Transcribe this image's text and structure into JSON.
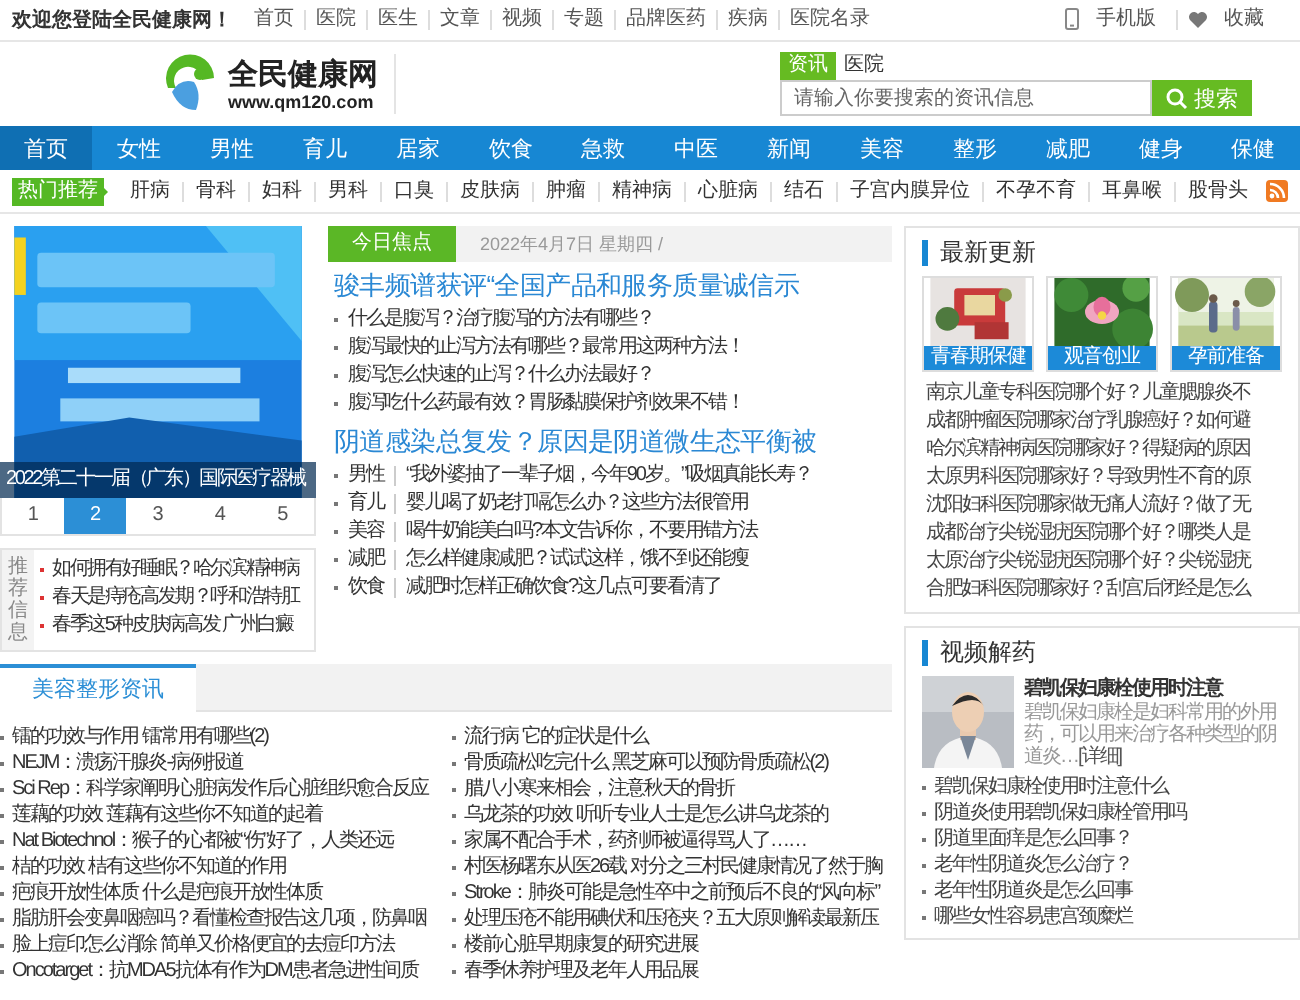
{
  "top_bar": {
    "welcome": "欢迎您登陆全民健康网！",
    "links": [
      "首页",
      "医院",
      "医生",
      "文章",
      "视频",
      "专题",
      "品牌医药",
      "疾病",
      "医院名录"
    ],
    "mobile": "手机版",
    "favorite": "收藏"
  },
  "header": {
    "logo_name": "全民健康网",
    "logo_url": "www.qm120.com",
    "search_tabs": [
      {
        "label": "资讯",
        "selected": true
      },
      {
        "label": "医院",
        "selected": false
      }
    ],
    "search": {
      "placeholder": "请输入你要搜索的资讯信息"
    },
    "search_button": "搜索"
  },
  "nav": [
    {
      "label": "首页",
      "selected": true
    },
    {
      "label": "女性",
      "selected": false
    },
    {
      "label": "男性",
      "selected": false
    },
    {
      "label": "育儿",
      "selected": false
    },
    {
      "label": "居家",
      "selected": false
    },
    {
      "label": "饮食",
      "selected": false
    },
    {
      "label": "急救",
      "selected": false
    },
    {
      "label": "中医",
      "selected": false
    },
    {
      "label": "新闻",
      "selected": false
    },
    {
      "label": "美容",
      "selected": false
    },
    {
      "label": "整形",
      "selected": false
    },
    {
      "label": "减肥",
      "selected": false
    },
    {
      "label": "健身",
      "selected": false
    },
    {
      "label": "保健",
      "selected": false
    }
  ],
  "hot": {
    "badge": "热门推荐",
    "tags": [
      "肝病",
      "骨科",
      "妇科",
      "男科",
      "口臭",
      "皮肤病",
      "肿瘤",
      "精神病",
      "心脏病",
      "结石",
      "子宫内膜异位",
      "不孕不育",
      "耳鼻喉",
      "股骨头"
    ]
  },
  "carousel": {
    "caption": "2022第二十一届（广东）国际医疗器械",
    "pages": [
      {
        "label": "1",
        "selected": false
      },
      {
        "label": "2",
        "selected": true
      },
      {
        "label": "3",
        "selected": false
      },
      {
        "label": "4",
        "selected": false
      },
      {
        "label": "5",
        "selected": false
      }
    ]
  },
  "recommend": {
    "label": "推荐信息",
    "items": [
      "如何拥有好睡眠？哈尔滨精神病",
      "春天是痔疮高发期？呼和浩特肛",
      "春季这5种皮肤病高发 广州白癜"
    ]
  },
  "focus": {
    "tab": "今日焦点",
    "date": "2022年4月7日 星期四 /",
    "groups": [
      {
        "headline": "骏丰频谱获评“全国产品和服务质量诚信示",
        "items": [
          {
            "title": "什么是腹泻？治疗腹泻的方法有哪些？"
          },
          {
            "title": "腹泻最快的止泻方法有哪些？最常用这两种方法！"
          },
          {
            "title": "腹泻怎么快速的止泻？什么办法最好？"
          },
          {
            "title": "腹泻吃什么药最有效？胃肠黏膜保护剂效果不错！"
          }
        ]
      },
      {
        "headline": "阴道感染总复发？原因是阴道微生态平衡被",
        "items": [
          {
            "category": "男性",
            "title": "“我外婆抽了一辈子烟，今年90岁。”吸烟真能长寿？"
          },
          {
            "category": "育儿",
            "title": "婴儿喝了奶老打嗝怎么办？这些方法很管用"
          },
          {
            "category": "美容",
            "title": "喝牛奶能美白吗?本文告诉你，不要用错方法"
          },
          {
            "category": "减肥",
            "title": "怎么样健康减肥？试试这样，饿不到还能瘦"
          },
          {
            "category": "饮食",
            "title": "减肥时怎样正确饮食?这几点可要看清了"
          }
        ]
      }
    ]
  },
  "latest": {
    "title": "最新更新",
    "captions": [
      "青春期保健",
      "观音创业",
      "孕前准备"
    ],
    "items": [
      "南京儿童专科医院哪个好？儿童腮腺炎不",
      "成都肿瘤医院哪家治疗乳腺癌好？如何避",
      "哈尔滨精神病医院哪家好？得疑病的原因",
      "太原男科医院哪家好？导致男性不育的原",
      "沈阳妇科医院哪家做无痛人流好？做了无",
      "成都治疗尖锐湿疣医院哪个好？哪类人是",
      "太原治疗尖锐湿疣医院哪个好？尖锐湿疣",
      "合肥妇科医院哪家好？刮宫后闭经是怎么"
    ]
  },
  "video": {
    "title": "视频解药",
    "feature": {
      "title": "碧凯保妇康栓使用时注意",
      "summary": "碧凯保妇康栓是妇科常用的外用药，可以用来治疗各种类型的阴道炎…",
      "more": "[详细]"
    },
    "items": [
      "碧凯保妇康栓使用时注意什么",
      "阴道炎使用碧凯保妇康栓管用吗",
      "阴道里面痒是怎么回事？",
      "老年性阴道炎怎么治疗？",
      "老年性阴道炎是怎么回事",
      "哪些女性容易患宫颈糜烂"
    ]
  },
  "beauty": {
    "tab": "美容整形资讯",
    "left_column": [
      "镭的功效与作用 镭常用有哪些(2)",
      "NEJM：溃疡汗腺炎-病例报道",
      "Sci Rep：科学家阐明心脏病发作后心脏组织愈合反应",
      "莲藕的功效 莲藕有这些你不知道的起着",
      "Nat Biotechnol：猴子的心都被“伤”好了，人类还远",
      "桔的功效 桔有这些你不知道的作用",
      "疤痕开放性体质 什么是疤痕开放性体质",
      "脂肪肝会变鼻咽癌吗？看懂检查报告这几项，防鼻咽",
      "脸上痘印怎么消除 简单又价格便宜的去痘印方法",
      "Oncotarget：抗MDA5抗体有作为DM患者急进性间质"
    ],
    "right_column": [
      "流行病 它的症状是什么",
      "骨质疏松吃完什么 黑芝麻可以预防骨质疏松(2)",
      "腊八小寒来相会，注意秋天的骨折",
      "乌龙茶的功效 听听专业人士是怎么讲乌龙茶的",
      "家属不配合手术，药剂师被逼得骂人了……",
      "村医杨曙东从医26载 对分之三村民健康情况了然于胸",
      "Stroke：肺炎可能是急性卒中之前预后不良的“风向标”",
      "处理压疮不能用碘伏和压疮夹？五大原则解读最新压",
      "楼前心脏早期康复的研究进展",
      "春季休养护理及老年人用品展"
    ]
  }
}
